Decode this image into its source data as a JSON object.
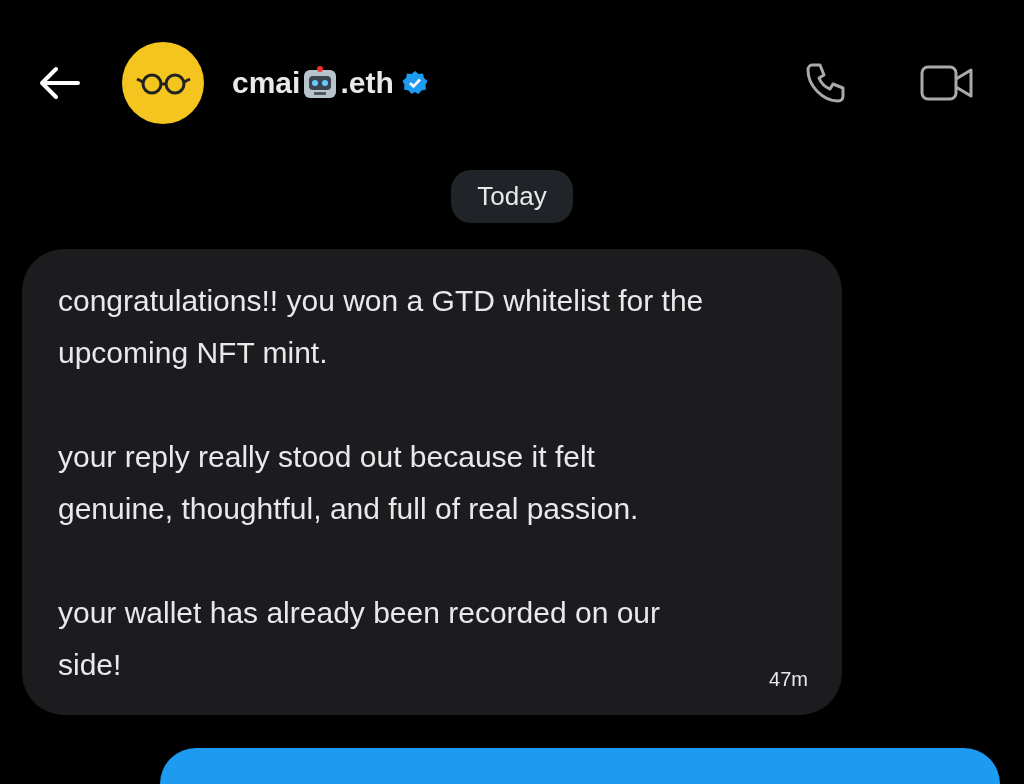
{
  "header": {
    "name_before_emoji": "cmai",
    "name_after_emoji": ".eth",
    "verified": true
  },
  "date_divider": "Today",
  "messages": [
    {
      "kind": "received",
      "paragraphs": [
        "congratulations!! you won a GTD whitelist for the upcoming NFT mint.",
        "your reply really stood out because it felt genuine, thoughtful, and full of real passion.",
        "your wallet has already been recorded on our side!"
      ],
      "time": "47m"
    },
    {
      "kind": "sent"
    }
  ]
}
